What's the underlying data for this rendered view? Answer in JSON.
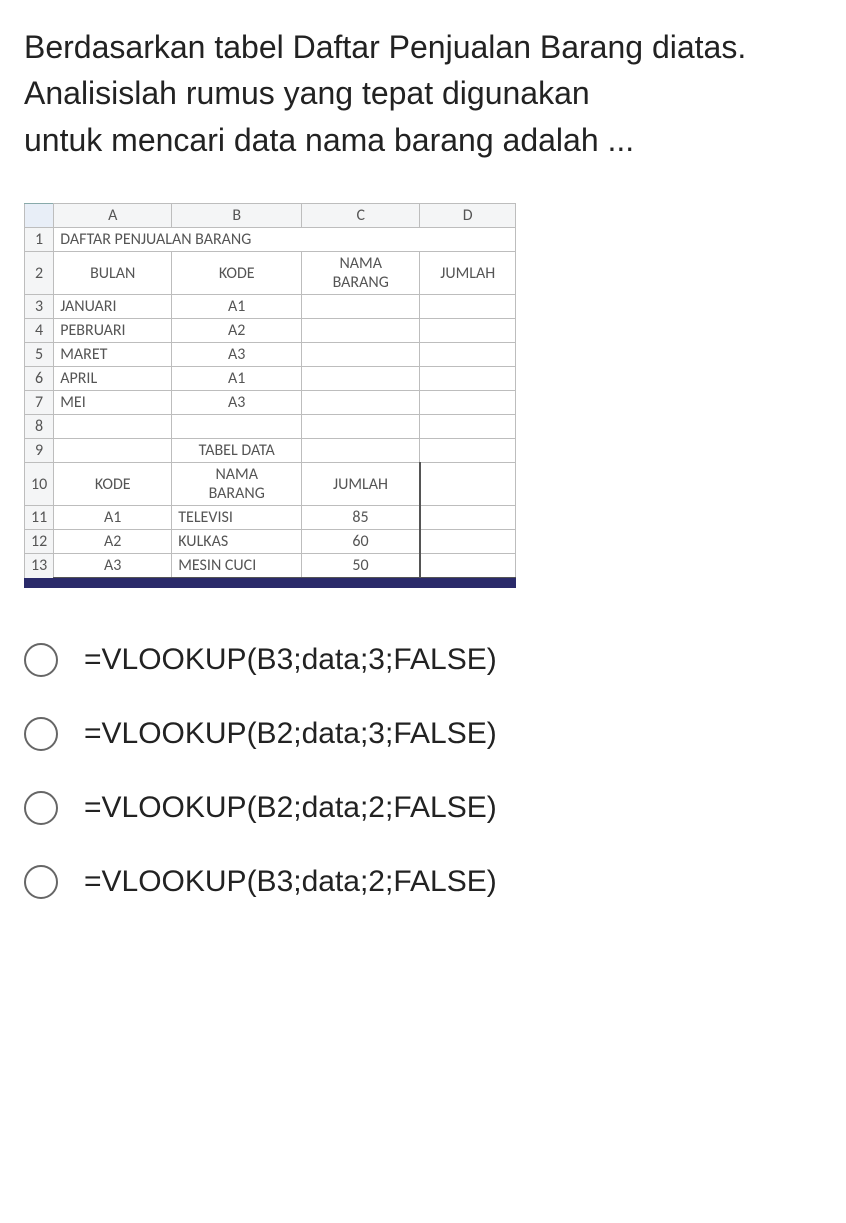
{
  "question": {
    "line1": "Berdasarkan tabel Daftar Penjualan Barang diatas. Analisislah rumus yang tepat digunakan",
    "line2": "untuk mencari data nama barang adalah ..."
  },
  "sheet": {
    "columns": [
      "A",
      "B",
      "C",
      "D"
    ],
    "row1_title": "DAFTAR PENJUALAN BARANG",
    "header2": {
      "a": "BULAN",
      "b": "KODE",
      "c1": "NAMA",
      "c2": "BARANG",
      "d": "JUMLAH"
    },
    "rows_top": [
      {
        "n": "3",
        "a": "JANUARI",
        "b": "A1"
      },
      {
        "n": "4",
        "a": "PEBRUARI",
        "b": "A2"
      },
      {
        "n": "5",
        "a": "MARET",
        "b": "A3"
      },
      {
        "n": "6",
        "a": "APRIL",
        "b": "A1"
      },
      {
        "n": "7",
        "a": "MEI",
        "b": "A3"
      }
    ],
    "row8": "8",
    "row9": {
      "n": "9",
      "title": "TABEL DATA"
    },
    "header10": {
      "n": "10",
      "a": "KODE",
      "b1": "NAMA",
      "b2": "BARANG",
      "c": "JUMLAH"
    },
    "rows_bottom": [
      {
        "n": "11",
        "a": "A1",
        "b": "TELEVISI",
        "c": "85"
      },
      {
        "n": "12",
        "a": "A2",
        "b": "KULKAS",
        "c": "60"
      },
      {
        "n": "13",
        "a": "A3",
        "b": "MESIN CUCI",
        "c": "50"
      }
    ]
  },
  "options": [
    "=VLOOKUP(B3;data;3;FALSE)",
    "=VLOOKUP(B2;data;3;FALSE)",
    "=VLOOKUP(B2;data;2;FALSE)",
    "=VLOOKUP(B3;data;2;FALSE)"
  ]
}
